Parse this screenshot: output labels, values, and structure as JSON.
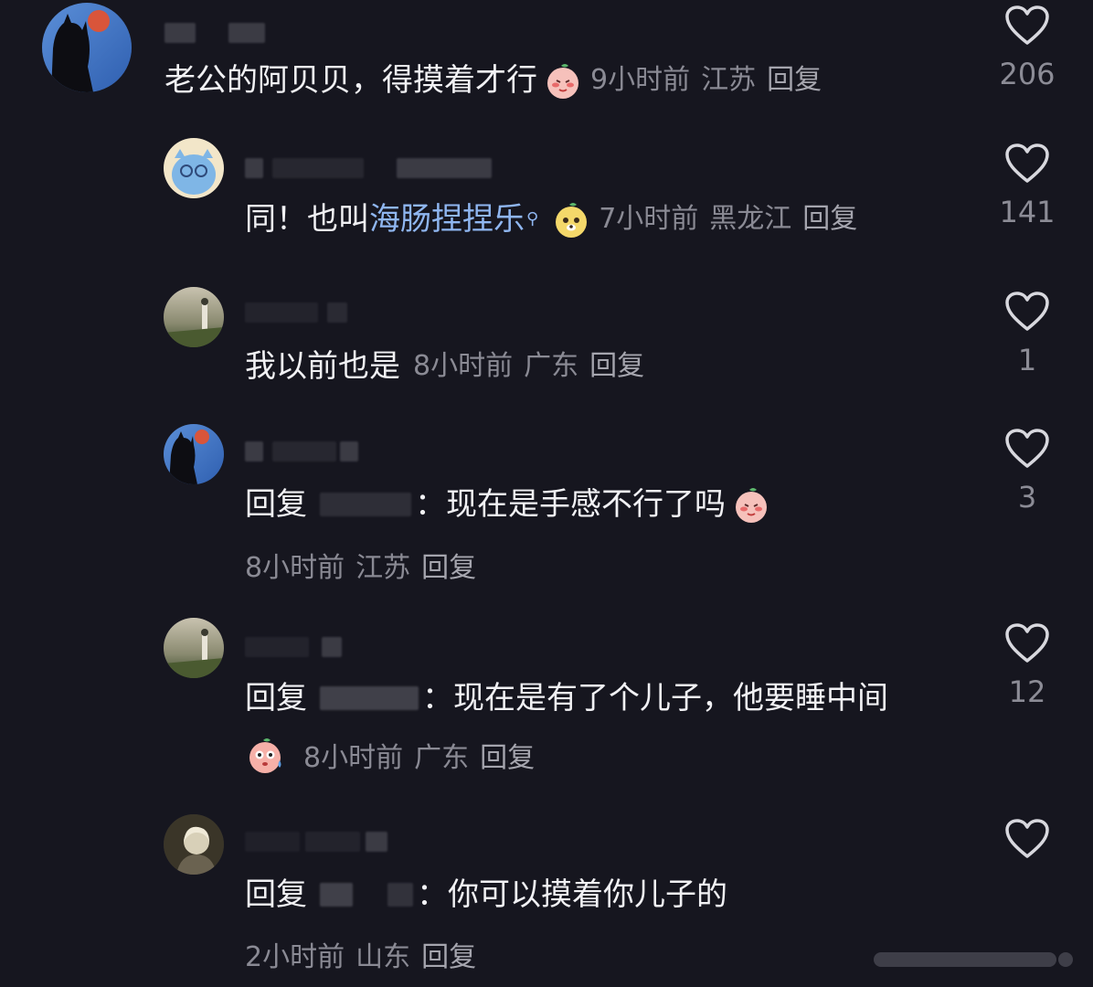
{
  "comments": [
    {
      "text": "老公的阿贝贝，得摸着才行",
      "time": "9小时前",
      "location": "江苏",
      "reply_label": "回复",
      "likes": "206",
      "emoji": "shy-peach-emoji"
    },
    {
      "text_prefix": "同！也叫 ",
      "link_text": "海肠捏捏乐",
      "search_glyph": "⚲",
      "time": "7小时前",
      "location": "黑龙江",
      "reply_label": "回复",
      "likes": "141",
      "emoji": "happy-dog-emoji"
    },
    {
      "text": "我以前也是",
      "time": "8小时前",
      "location": "广东",
      "reply_label": "回复",
      "likes": "1"
    },
    {
      "reply_prefix": "回复",
      "text": "：现在是手感不行了吗",
      "time": "8小时前",
      "location": "江苏",
      "reply_label": "回复",
      "likes": "3",
      "emoji": "shy-peach-emoji"
    },
    {
      "reply_prefix": "回复",
      "text": "：现在是有了个儿子，他要睡中间",
      "time": "8小时前",
      "location": "广东",
      "reply_label": "回复",
      "likes": "12",
      "emoji": "sweat-face-emoji"
    },
    {
      "reply_prefix": "回复",
      "text": "：你可以摸着你儿子的",
      "time": "2小时前",
      "location": "山东",
      "reply_label": "回复",
      "likes": ""
    }
  ],
  "colors": {
    "background": "#16161f",
    "text": "#f1f1f4",
    "meta": "#8a8a94",
    "link": "#8fb6f0"
  }
}
